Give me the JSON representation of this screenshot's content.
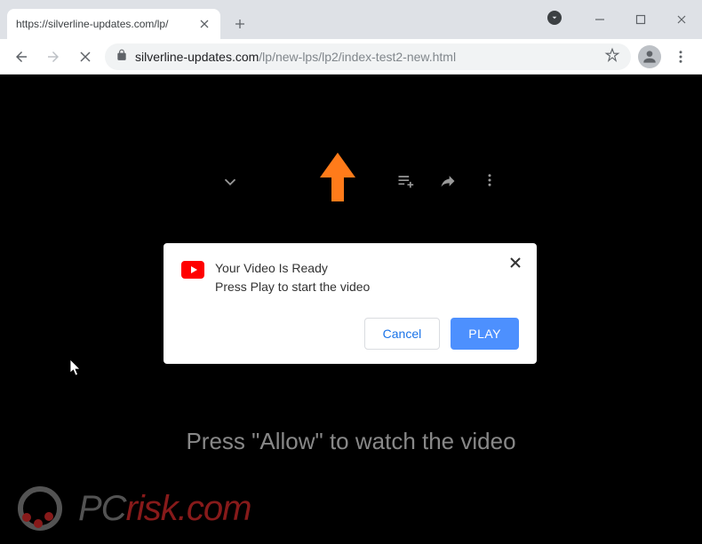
{
  "tab": {
    "title": "https://silverline-updates.com/lp/"
  },
  "url": {
    "host": "silverline-updates.com",
    "path": "/lp/new-lps/lp2/index-test2-new.html"
  },
  "dialog": {
    "line1": "Your Video Is Ready",
    "line2": "Press Play to start the video",
    "cancel": "Cancel",
    "play": "PLAY"
  },
  "content": {
    "allow_text": "Press \"Allow\" to watch the video"
  },
  "watermark": {
    "brand_prefix": "PC",
    "brand_suffix": "risk.com"
  }
}
